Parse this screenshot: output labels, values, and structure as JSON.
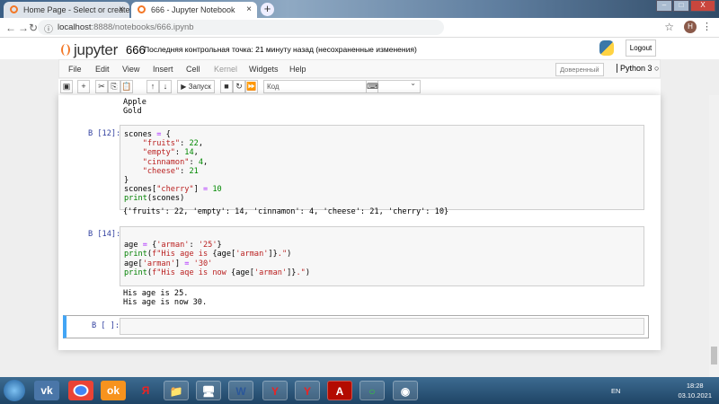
{
  "browser": {
    "tabs": [
      {
        "title": "Home Page - Select or create a n"
      },
      {
        "title": "666 - Jupyter Notebook"
      }
    ],
    "url_host": "localhost",
    "url_path": ":8888/notebooks/666.ipynb",
    "avatar": "H"
  },
  "header": {
    "logo": "jupyter",
    "notebook_name": "666",
    "checkpoint": "Последняя контрольная точка: 21 минуту назад  (несохраненные изменения)",
    "logout": "Logout"
  },
  "menu": {
    "items": [
      "File",
      "Edit",
      "View",
      "Insert",
      "Cell",
      "Kernel",
      "Widgets",
      "Help"
    ],
    "trusted": "Доверенный",
    "kernel": "Python 3"
  },
  "toolbar": {
    "run": "▶ Запуск",
    "cell_type": "Код"
  },
  "cells": [
    {
      "output": "Apple\nGold"
    },
    {
      "prompt": "В [12]:",
      "code": [
        [
          [
            "scones ",
            ""
          ],
          [
            "=",
            "op"
          ],
          [
            " {",
            ""
          ]
        ],
        [
          [
            "    ",
            ""
          ],
          [
            "\"fruits\"",
            "st"
          ],
          [
            ": ",
            ""
          ],
          [
            "22",
            "nu"
          ],
          [
            ",",
            ""
          ]
        ],
        [
          [
            "    ",
            ""
          ],
          [
            "\"empty\"",
            "st"
          ],
          [
            ": ",
            ""
          ],
          [
            "14",
            "nu"
          ],
          [
            ",",
            ""
          ]
        ],
        [
          [
            "    ",
            ""
          ],
          [
            "\"cinnamon\"",
            "st"
          ],
          [
            ": ",
            ""
          ],
          [
            "4",
            "nu"
          ],
          [
            ",",
            ""
          ]
        ],
        [
          [
            "    ",
            ""
          ],
          [
            "\"cheese\"",
            "st"
          ],
          [
            ": ",
            ""
          ],
          [
            "21",
            "nu"
          ]
        ],
        [
          [
            "}",
            ""
          ]
        ],
        [
          [
            "scones[",
            ""
          ],
          [
            "\"cherry\"",
            "st"
          ],
          [
            "] ",
            ""
          ],
          [
            "=",
            "op"
          ],
          [
            " ",
            ""
          ],
          [
            "10",
            "nu"
          ]
        ],
        [
          [
            "print",
            "kw"
          ],
          [
            "(scones)",
            ""
          ]
        ]
      ],
      "output": "{'fruits': 22, 'empty': 14, 'cinnamon': 4, 'cheese': 21, 'cherry': 10}"
    },
    {
      "prompt": "В [14]:",
      "code": [
        [
          [
            "",
            ""
          ]
        ],
        [
          [
            "age ",
            ""
          ],
          [
            "=",
            "op"
          ],
          [
            " {",
            ""
          ],
          [
            "'arman'",
            "st"
          ],
          [
            ": ",
            ""
          ],
          [
            "'25'",
            "st"
          ],
          [
            "}",
            ""
          ]
        ],
        [
          [
            "print",
            "kw"
          ],
          [
            "(",
            ""
          ],
          [
            "f\"His age is ",
            "st"
          ],
          [
            "{age[",
            ""
          ],
          [
            "'arman'",
            "st"
          ],
          [
            "]}",
            ""
          ],
          [
            ".\"",
            "st"
          ],
          [
            ")",
            ""
          ]
        ],
        [
          [
            "age[",
            ""
          ],
          [
            "'arman'",
            "st"
          ],
          [
            "] ",
            ""
          ],
          [
            "=",
            "op"
          ],
          [
            " ",
            ""
          ],
          [
            "'30'",
            "st"
          ]
        ],
        [
          [
            "print",
            "kw"
          ],
          [
            "(",
            ""
          ],
          [
            "f\"His aqe is now ",
            "st"
          ],
          [
            "{age[",
            ""
          ],
          [
            "'arman'",
            "st"
          ],
          [
            "]}",
            ""
          ],
          [
            ".\"",
            "st"
          ],
          [
            ")",
            ""
          ]
        ],
        [
          [
            "",
            ""
          ]
        ]
      ],
      "output": "His age is 25.\nHis age is now 30."
    },
    {
      "prompt": "В [ ]:"
    }
  ],
  "taskbar": {
    "lang": "EN",
    "time": "18:28",
    "date": "03.10.2021"
  }
}
